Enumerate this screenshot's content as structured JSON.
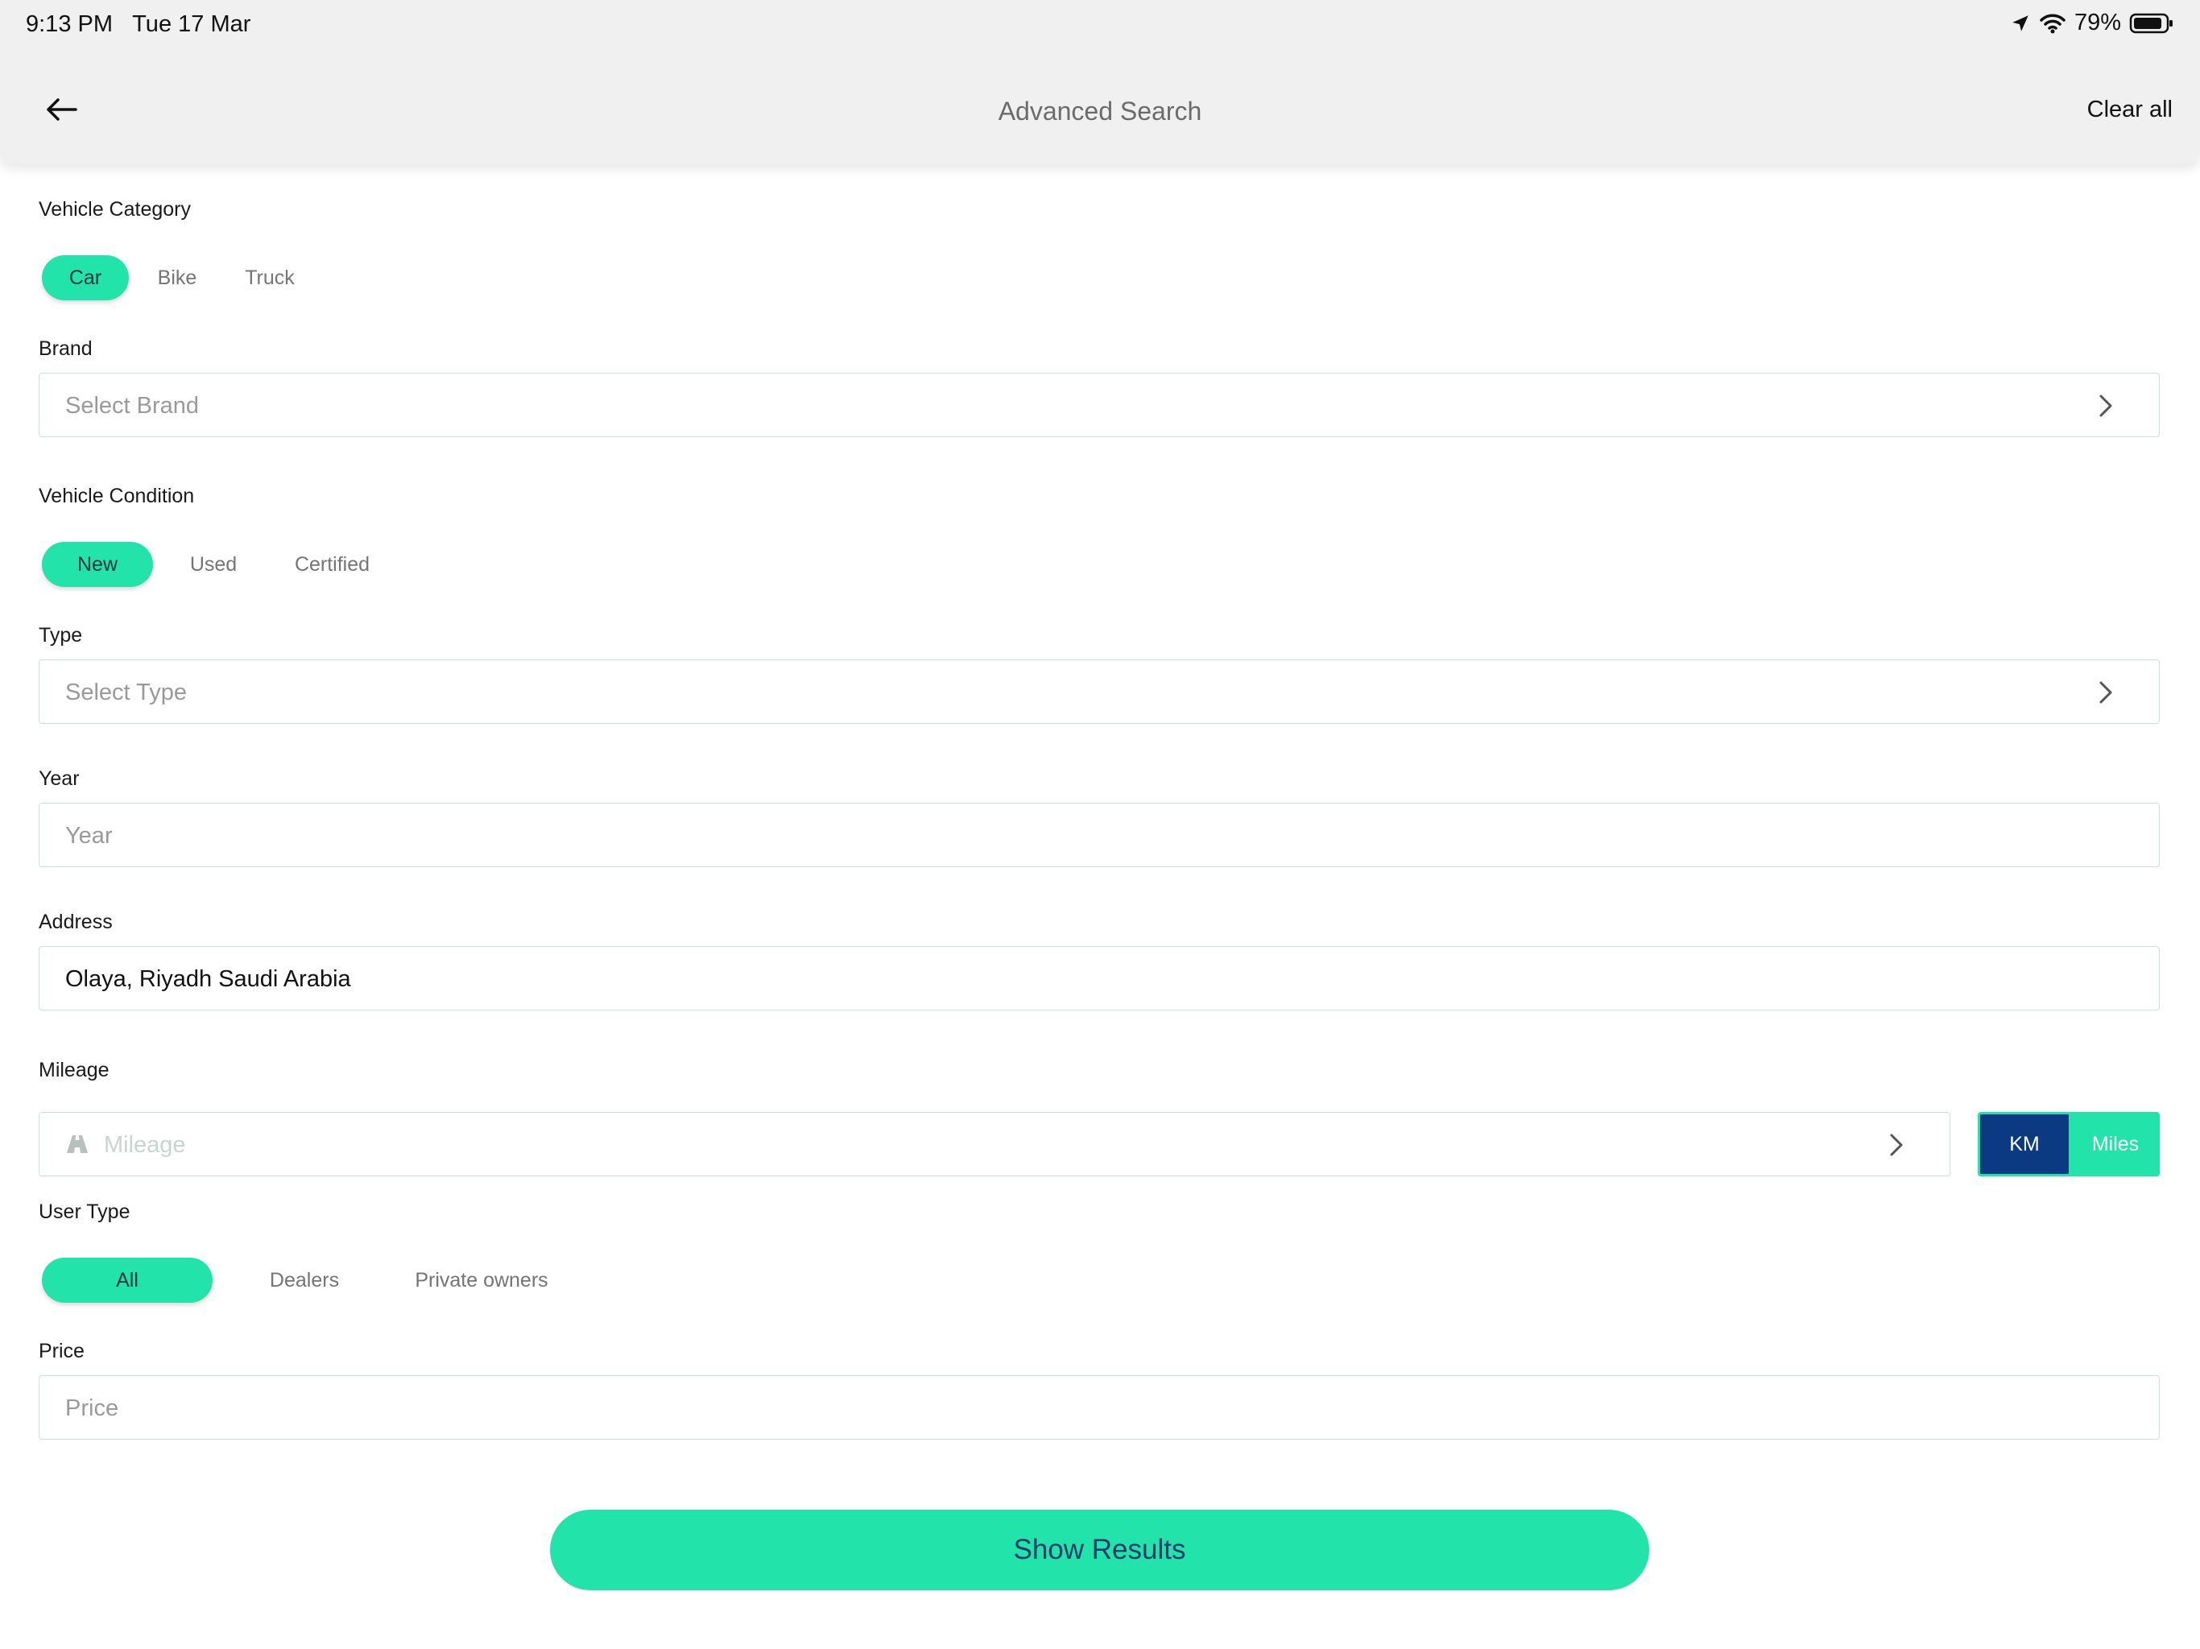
{
  "status_bar": {
    "time": "9:13 PM",
    "date": "Tue 17 Mar",
    "battery": "79%"
  },
  "header": {
    "title": "Advanced Search",
    "clear_label": "Clear all",
    "back_icon": "arrow-left-icon"
  },
  "vehicle_category": {
    "label": "Vehicle Category",
    "options": [
      "Car",
      "Bike",
      "Truck"
    ],
    "selected": "Car"
  },
  "brand": {
    "label": "Brand",
    "placeholder": "Select Brand"
  },
  "vehicle_condition": {
    "label": "Vehicle Condition",
    "options": [
      "New",
      "Used",
      "Certified"
    ],
    "selected": "New"
  },
  "type": {
    "label": "Type",
    "placeholder": "Select Type"
  },
  "year": {
    "label": "Year",
    "placeholder": "Year"
  },
  "address": {
    "label": "Address",
    "value": "Olaya, Riyadh Saudi Arabia"
  },
  "mileage": {
    "label": "Mileage",
    "placeholder": "Mileage",
    "units": [
      "KM",
      "Miles"
    ],
    "selected_unit": "KM"
  },
  "user_type": {
    "label": "User Type",
    "options": [
      "All",
      "Dealers",
      "Private owners"
    ],
    "selected": "All"
  },
  "price": {
    "label": "Price",
    "placeholder": "Price"
  },
  "actions": {
    "show_results": "Show Results"
  },
  "colors": {
    "accent": "#22e3a9",
    "navy": "#0c3a82",
    "header_bg": "#eff0ef"
  }
}
